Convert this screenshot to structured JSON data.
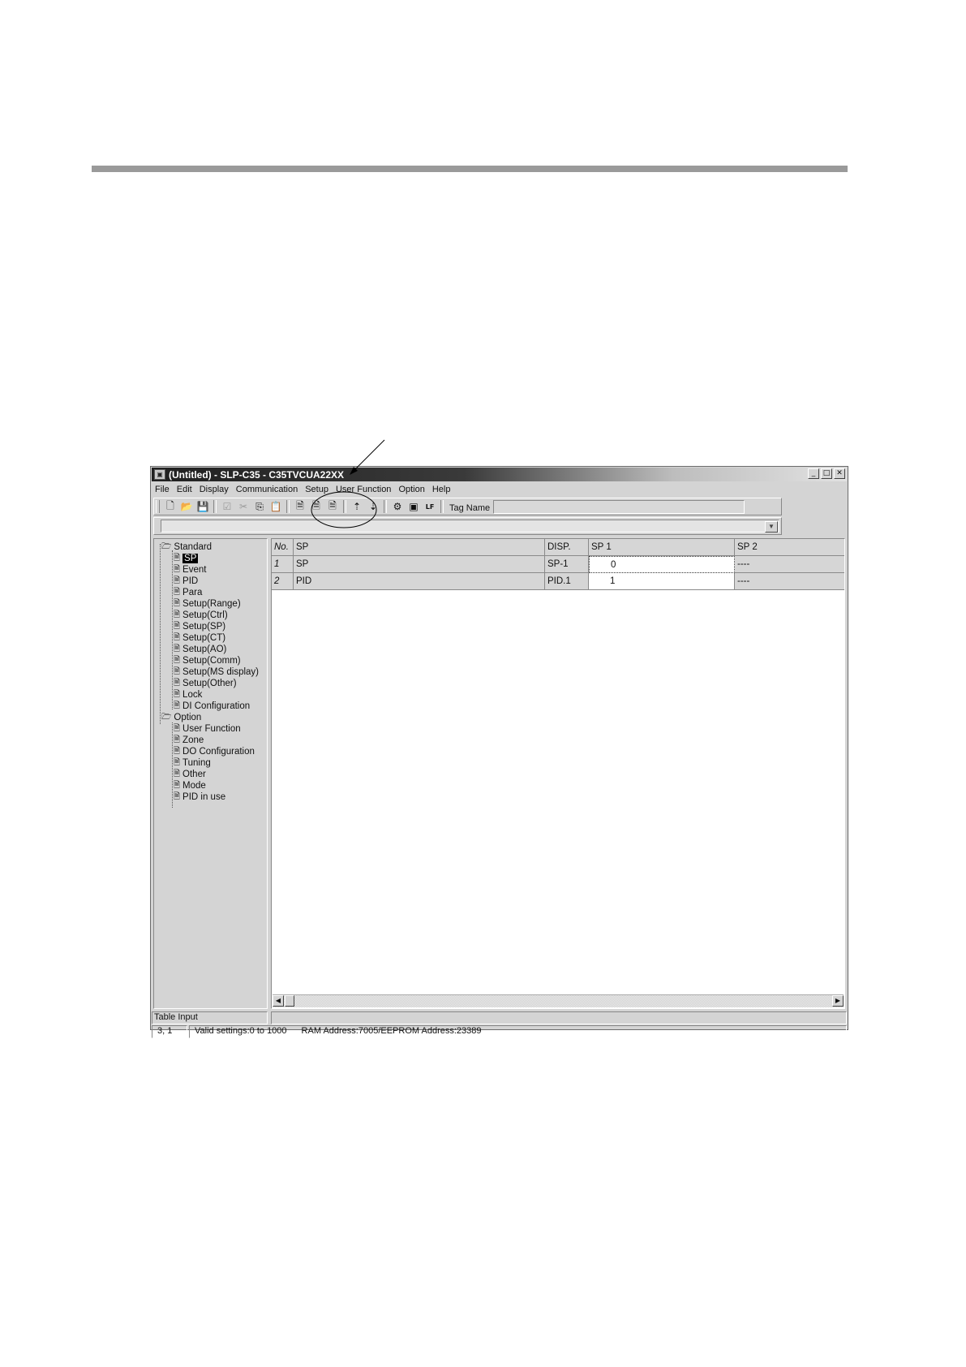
{
  "window": {
    "title": "(Untitled) - SLP-C35 - C35TVCUA22XX",
    "controls": {
      "minimize": "_",
      "maximize": "□",
      "close": "✕"
    }
  },
  "menu": [
    "File",
    "Edit",
    "Display",
    "Communication",
    "Setup",
    "User Function",
    "Option",
    "Help"
  ],
  "toolbar": {
    "buttons": [
      {
        "icon": "new-file-icon",
        "glyph": "🗋"
      },
      {
        "icon": "open-folder-icon",
        "glyph": "📂"
      },
      {
        "icon": "save-disk-icon",
        "glyph": "💾"
      },
      {
        "icon": "check-icon",
        "glyph": "☑",
        "disabled": true
      },
      {
        "icon": "cut-icon",
        "glyph": "✂",
        "disabled": true
      },
      {
        "icon": "copy-icon",
        "glyph": "⎘"
      },
      {
        "icon": "paste-icon",
        "glyph": "📋"
      },
      {
        "icon": "page-view-1-icon",
        "glyph": "🗎"
      },
      {
        "icon": "page-view-2-icon",
        "glyph": "🗎"
      },
      {
        "icon": "page-view-3-icon",
        "glyph": "🗎"
      },
      {
        "icon": "upload-slp-icon",
        "glyph": "⇡"
      },
      {
        "icon": "download-slp-icon",
        "glyph": "⇣"
      },
      {
        "icon": "property-icon",
        "glyph": "⚙"
      },
      {
        "icon": "monitor-icon",
        "glyph": "▣"
      },
      {
        "icon": "lf-icon",
        "glyph": "LF"
      }
    ],
    "tag_name_label": "Tag Name",
    "tag_name_value": ""
  },
  "tree": {
    "groups": [
      {
        "label": "Standard",
        "items": [
          "SP",
          "Event",
          "PID",
          "Para",
          "Setup(Range)",
          "Setup(Ctrl)",
          "Setup(SP)",
          "Setup(CT)",
          "Setup(AO)",
          "Setup(Comm)",
          "Setup(MS display)",
          "Setup(Other)",
          "Lock",
          "DI Configuration"
        ],
        "selected": "SP"
      },
      {
        "label": "Option",
        "items": [
          "User Function",
          "Zone",
          "DO Configuration",
          "Tuning",
          "Other",
          "Mode",
          "PID in use"
        ]
      }
    ]
  },
  "grid": {
    "columns": [
      "No.",
      "SP",
      "DISP.",
      "SP 1",
      "SP 2"
    ],
    "rows": [
      [
        "1",
        "SP",
        "SP-1",
        "0",
        "----"
      ],
      [
        "2",
        "PID",
        "PID.1",
        "1",
        "----"
      ]
    ]
  },
  "status": {
    "mode": "Table Input",
    "position": "3, 1",
    "valid": "Valid settings:0 to 1000",
    "address": "RAM Address:7005/EEPROM Address:23389"
  }
}
